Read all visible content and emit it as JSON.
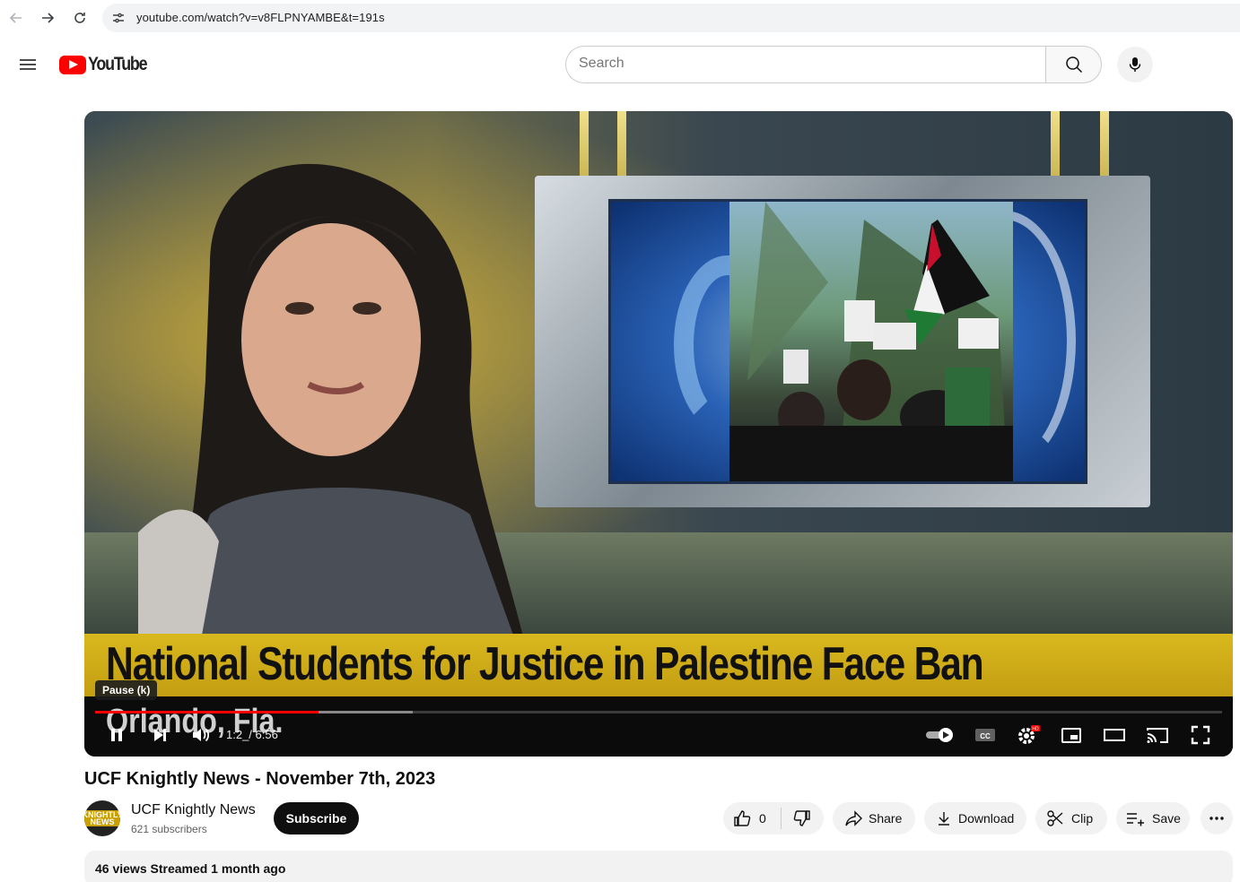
{
  "browser": {
    "url": "youtube.com/watch?v=v8FLPNYAMBE&t=191s"
  },
  "header": {
    "logo_text": "YouTube",
    "search_placeholder": "Search"
  },
  "player": {
    "ticker_headline": "National Students for Justice in Palestine Face Ban",
    "location_caption": "Orlando, Fla.",
    "tooltip": "Pause (k)",
    "time_display": "1:2_/ 6:56",
    "progress_played": 0.198,
    "progress_buffered": 0.282
  },
  "video": {
    "title": "UCF Knightly News - November 7th, 2023",
    "channel_name": "UCF Knightly News",
    "avatar_text": "KNIGHTLY NEWS",
    "subscribers": "621 subscribers",
    "subscribe_label": "Subscribe",
    "like_count": "0",
    "share_label": "Share",
    "download_label": "Download",
    "clip_label": "Clip",
    "save_label": "Save"
  },
  "description": {
    "meta": "46 views  Streamed 1 month ago"
  },
  "colors": {
    "brand_red": "#ff0000",
    "ticker_yellow": "#d9b81e"
  }
}
